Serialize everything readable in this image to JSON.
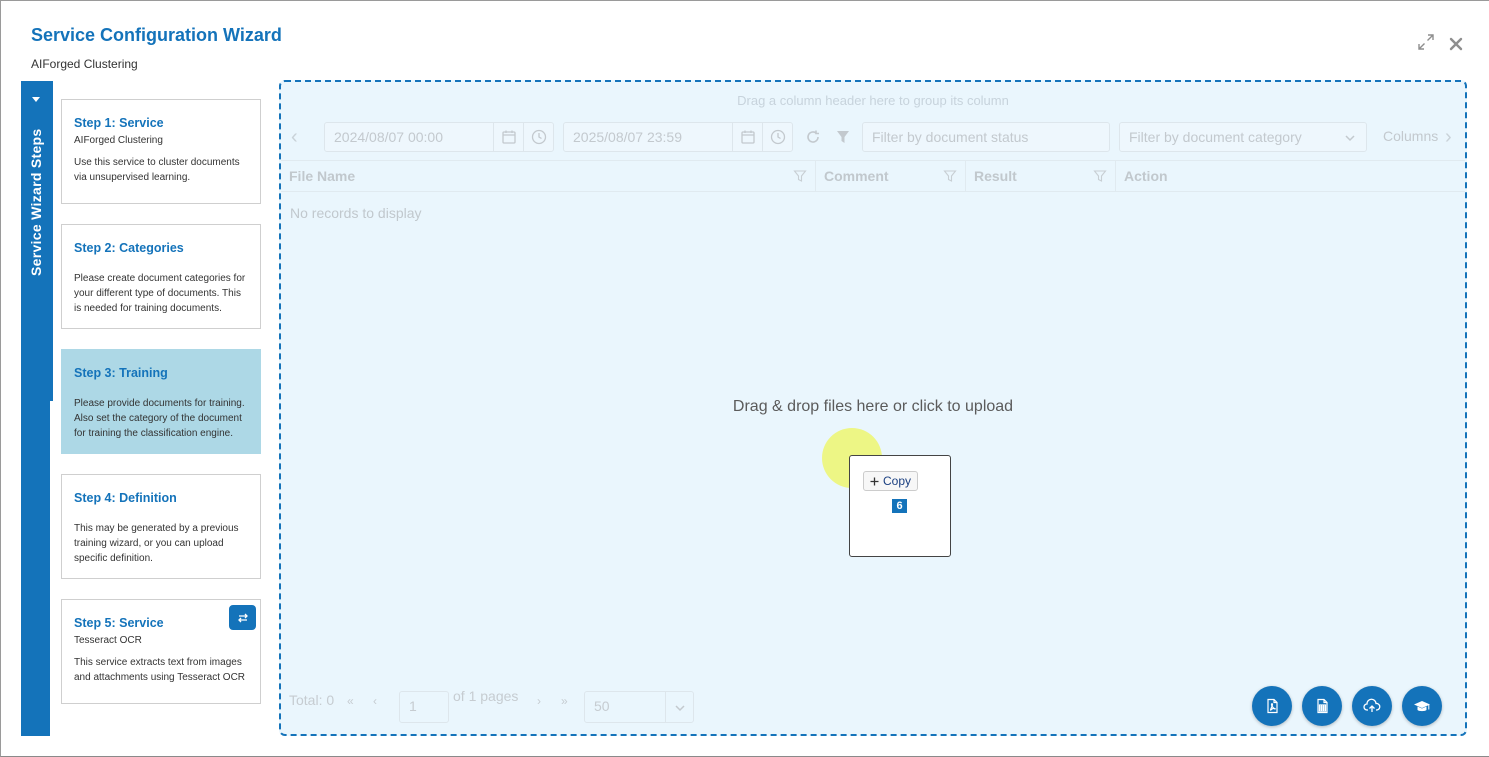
{
  "window": {
    "title": "Service Configuration Wizard",
    "subtitle": "AIForged Clustering"
  },
  "sidebar": {
    "tab_label": "Service Wizard Steps",
    "steps": [
      {
        "title": "Step 1: Service",
        "subtitle": "AIForged Clustering",
        "description": "Use this service to cluster documents via unsupervised learning.",
        "active": false
      },
      {
        "title": "Step 2: Categories",
        "subtitle": "",
        "description": "Please create document categories for your different type of documents. This is needed for training documents.",
        "active": false
      },
      {
        "title": "Step 3: Training",
        "subtitle": "",
        "description": "Please provide documents for training. Also set the category of the document for training the classification engine.",
        "active": true
      },
      {
        "title": "Step 4: Definition",
        "subtitle": "",
        "description": "This may be generated by a previous training wizard, or you can upload specific definition.",
        "active": false
      },
      {
        "title": "Step 5: Service",
        "subtitle": "Tesseract OCR",
        "description": "This service extracts text from images and attachments using Tesseract OCR",
        "active": false
      }
    ]
  },
  "grid": {
    "group_hint": "Drag a column header here to group its column",
    "toolbar": {
      "start_date": "2024/08/07 00:00",
      "end_date": "2025/08/07 23:59",
      "status_placeholder": "Filter by document status",
      "category_placeholder": "Filter by document category",
      "columns_label": "Columns"
    },
    "columns": [
      "File Name",
      "Comment",
      "Result",
      "Action"
    ],
    "no_records": "No records to display",
    "pager": {
      "total": "Total: 0",
      "page": "1",
      "of_pages": "of 1 pages",
      "page_size": "50"
    }
  },
  "dropzone": {
    "message": "Drag & drop files here or click to upload"
  },
  "drag_ghost": {
    "action": "Copy",
    "count": "6"
  },
  "actions": {
    "icons": [
      "pdf-file-icon",
      "spreadsheet-file-icon",
      "cloud-upload-icon",
      "graduation-cap-icon"
    ]
  },
  "colors": {
    "accent": "#1473ba",
    "active_step": "#add8e6",
    "dropzone_bg": "#eaf6fd"
  }
}
